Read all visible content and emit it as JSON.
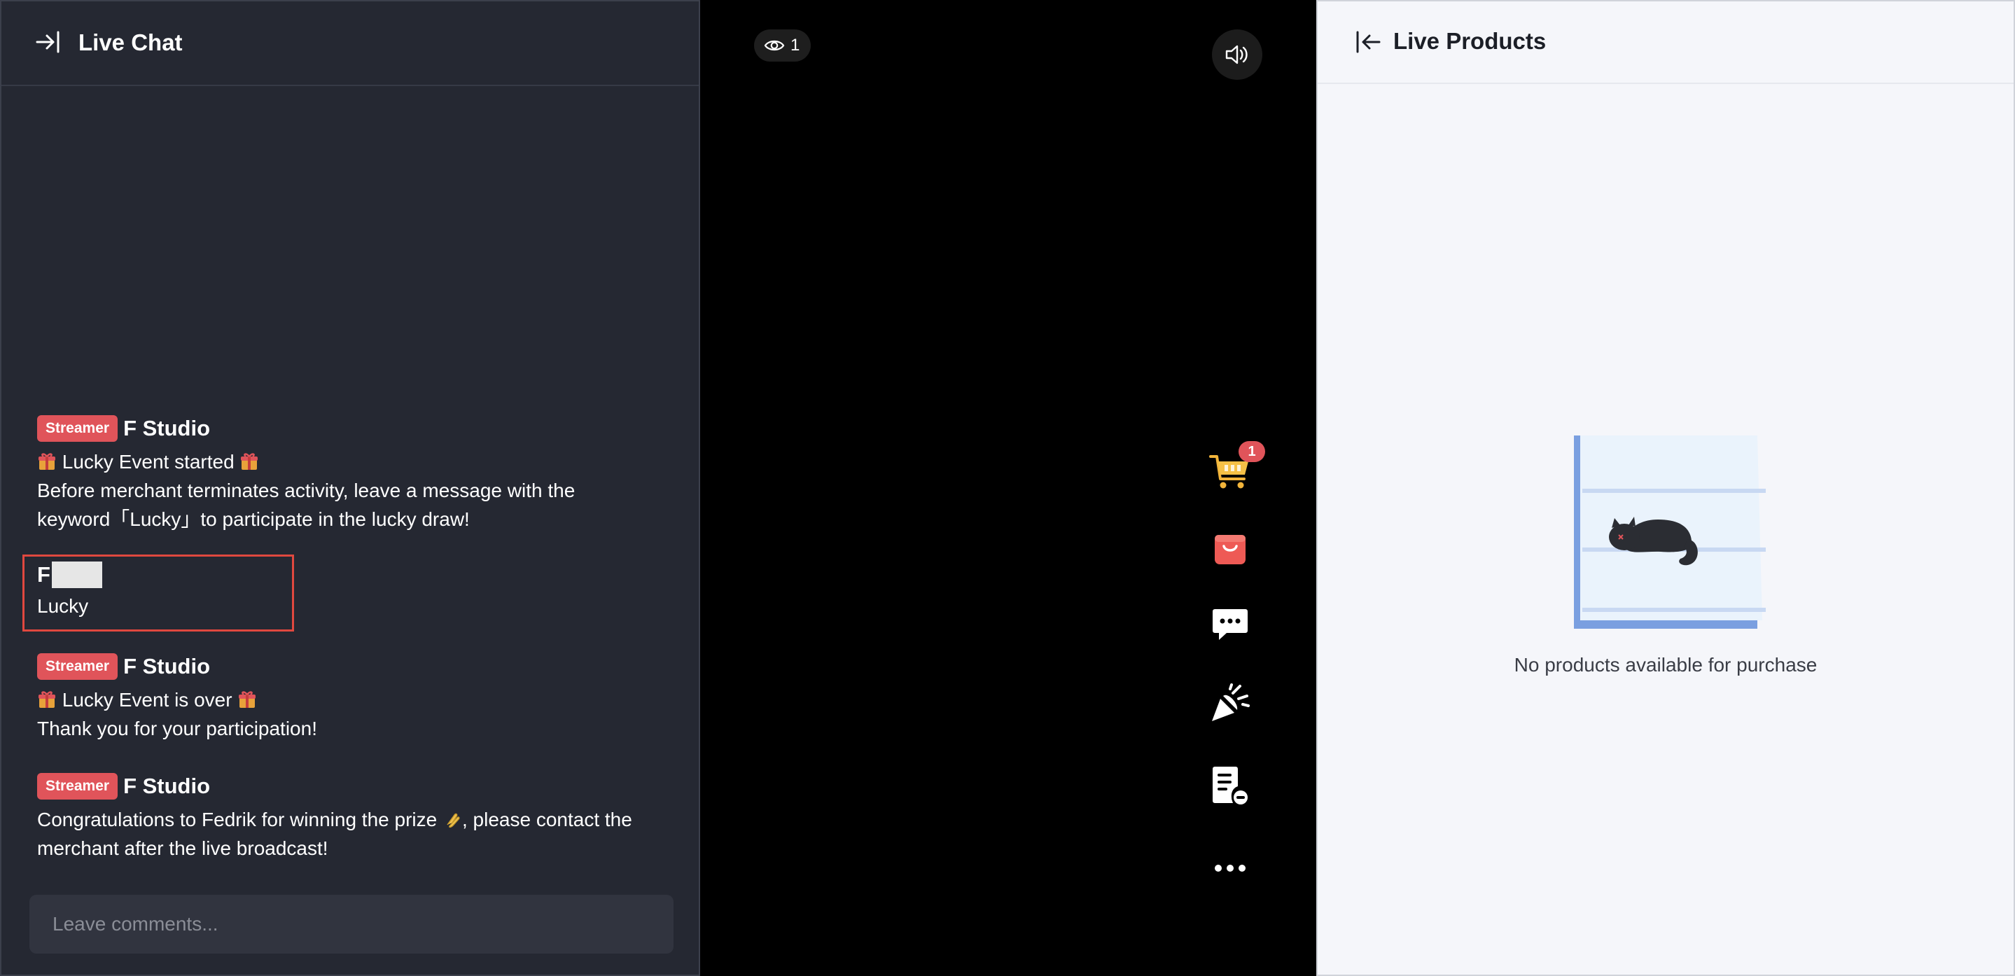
{
  "chat": {
    "title": "Live Chat",
    "icons": {
      "collapse": "collapse-right-icon",
      "gift": "gift-icon",
      "clap": "clap-icon"
    },
    "messages": [
      {
        "badge": "Streamer",
        "sender": "F Studio",
        "lines": [
          "Lucky  Event started",
          "Before merchant terminates activity, leave a message with the",
          "keyword「Lucky」to participate in the lucky draw!"
        ]
      },
      {
        "sender": "F",
        "lines": [
          "Lucky"
        ],
        "highlighted": true
      },
      {
        "badge": "Streamer",
        "sender": "F Studio",
        "lines": [
          "Lucky  Event is over",
          "Thank you for your participation!"
        ]
      },
      {
        "badge": "Streamer",
        "sender": "F Studio",
        "lines": [
          "Congratulations to Fedrik for winning the prize",
          ", please contact the",
          "merchant after the live broadcast!"
        ]
      }
    ],
    "input_placeholder": "Leave comments...",
    "colors": {
      "background": "#252832",
      "badge": "#e0545a",
      "highlight": "#e0483f"
    }
  },
  "video": {
    "viewer_count": "1",
    "icons": {
      "viewers": "eye-icon",
      "volume": "volume-icon",
      "cart": "shopping-cart-icon",
      "bag": "shopping-bag-icon",
      "chat": "chat-bubble-icon",
      "promo": "party-popper-icon",
      "notes": "document-minus-icon",
      "more": "more-dots-icon"
    },
    "cart_count": "1"
  },
  "products": {
    "title": "Live Products",
    "back_icon": "back-arrow-icon",
    "empty_text": "No products available for purchase",
    "illustration": "empty-shelf-cat-illustration"
  }
}
